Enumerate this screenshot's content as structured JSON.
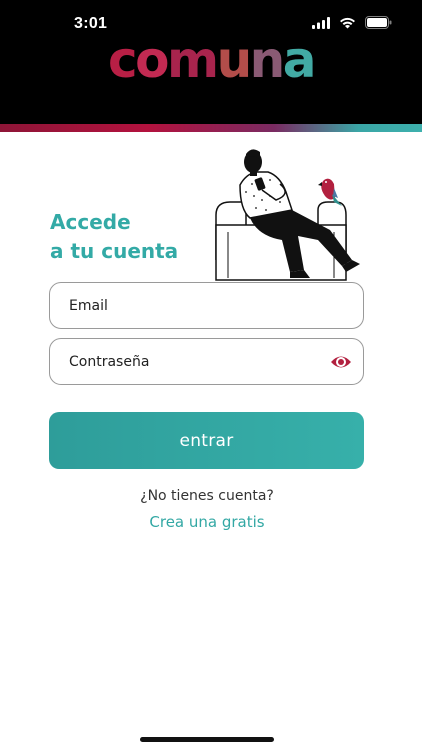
{
  "status_bar": {
    "time": "3:01"
  },
  "brand": {
    "letters": [
      "c",
      "o",
      "m",
      "u",
      "n",
      "a"
    ],
    "letter_colors": [
      "#b81f45",
      "#c22a52",
      "#a8244d",
      "#b24d4a",
      "#8a5a74",
      "#42aaa4"
    ]
  },
  "login": {
    "title_line1": "Accede",
    "title_line2": "a tu cuenta",
    "email_placeholder": "Email",
    "password_placeholder": "Contraseña",
    "submit_label": "entrar",
    "no_account_text": "¿No tienes cuenta?",
    "create_account_link": "Crea una gratis"
  },
  "colors": {
    "accent_teal": "#33aaa6",
    "eye_icon": "#b2203f",
    "header_bg": "#000000"
  }
}
